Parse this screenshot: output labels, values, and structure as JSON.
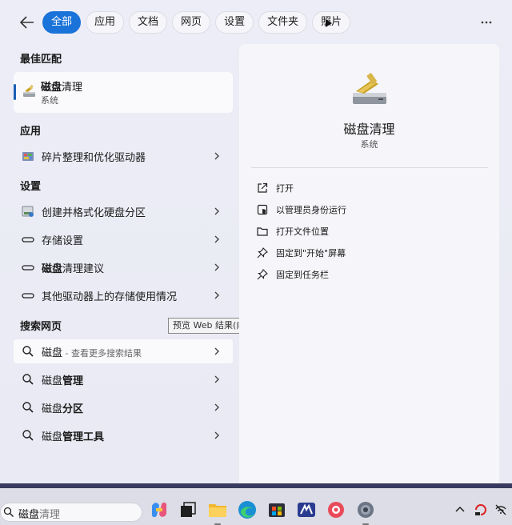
{
  "filters": {
    "tabs": [
      {
        "label": "全部",
        "active": true
      },
      {
        "label": "应用",
        "active": false
      },
      {
        "label": "文档",
        "active": false
      },
      {
        "label": "网页",
        "active": false
      },
      {
        "label": "设置",
        "active": false
      },
      {
        "label": "文件夹",
        "active": false
      },
      {
        "label": "照片",
        "active": false
      }
    ],
    "back_icon": "arrow-left-icon",
    "play_icon": "play-icon",
    "more_icon": "more-horizontal-icon"
  },
  "best_match": {
    "heading": "最佳匹配",
    "title_bold": "磁盘",
    "title_rest": "清理",
    "subtitle": "系统",
    "icon": "disk-cleanup-icon"
  },
  "apps": {
    "heading": "应用",
    "items": [
      {
        "label": "碎片整理和优化驱动器",
        "icon": "defrag-icon"
      }
    ]
  },
  "settings": {
    "heading": "设置",
    "items": [
      {
        "label": "创建并格式化硬盘分区",
        "icon": "disk-management-icon"
      },
      {
        "label": "存储设置",
        "icon": "drive-icon"
      },
      {
        "label_bold": "磁盘",
        "label_rest": "清理建议",
        "icon": "drive-icon"
      },
      {
        "label": "其他驱动器上的存储使用情况",
        "icon": "drive-icon"
      }
    ]
  },
  "web": {
    "heading": "搜索网页",
    "items": [
      {
        "label_main": "磁盘",
        "label_rest": " - 查看更多搜索结果",
        "icon": "search-icon"
      },
      {
        "label_main": "磁盘",
        "label_rest": "管理",
        "icon": "search-icon"
      },
      {
        "label_main": "磁盘",
        "label_rest": "分区",
        "icon": "search-icon"
      },
      {
        "label_main": "磁盘",
        "label_rest": "管理工具",
        "icon": "search-icon"
      }
    ]
  },
  "tooltip": "预览 Web 结果(向右键)",
  "detail": {
    "title": "磁盘清理",
    "subtitle": "系统",
    "actions": [
      {
        "label": "打开",
        "icon": "open-external-icon"
      },
      {
        "label": "以管理员身份运行",
        "icon": "shield-admin-icon"
      },
      {
        "label": "打开文件位置",
        "icon": "folder-icon"
      },
      {
        "label": "固定到\"开始\"屏幕",
        "icon": "pin-icon"
      },
      {
        "label": "固定到任务栏",
        "icon": "pin-icon"
      }
    ]
  },
  "taskbar": {
    "search_typed": "磁盘",
    "search_suggestion": "清理",
    "apps": [
      "copilot-icon",
      "task-view-icon",
      "file-explorer-icon",
      "edge-icon",
      "store-icon",
      "app-icon",
      "app-icon",
      "settings-gear-icon"
    ],
    "tray": [
      "chevron-up-icon",
      "app-icon",
      "network-off-icon"
    ]
  },
  "colors": {
    "accent": "#1a73d8",
    "taskbar_border": "#383a60"
  }
}
